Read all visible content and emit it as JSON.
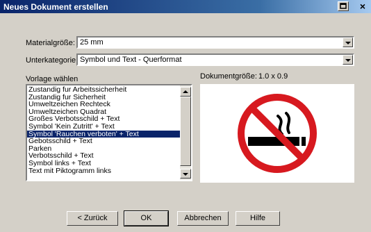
{
  "window": {
    "title": "Neues Dokument erstellen",
    "close_glyph": "×"
  },
  "material": {
    "label": "Materialgröße:",
    "value": "25 mm"
  },
  "subcategory": {
    "label": "Unterkategorie:",
    "value": "Symbol und Text - Querformat"
  },
  "template": {
    "label": "Vorlage wählen",
    "items": [
      "Zustandig fur Arbeitssicherheit",
      "Zustandig fur Sicherheit",
      "Umweltzeichen Rechteck",
      "Umweltzeichen Quadrat",
      "Großes Verbotsschild + Text",
      "Symbol 'Kein Zutritt' + Text",
      "Symbol 'Rauchen verboten' + Text",
      "Gebotsschild + Text",
      "Parken",
      "Verbotsschild + Text",
      "Symbol links + Text",
      "Text mit Piktogramm links"
    ],
    "selected_index": 6
  },
  "document_size": {
    "label": "Dokumentgröße:",
    "value": "1.0 x 0.9"
  },
  "preview": {
    "icon": "no-smoking-icon",
    "colors": {
      "ring": "#d7191f",
      "symbol": "#000000"
    }
  },
  "buttons": {
    "back": "< Zurück",
    "ok": "OK",
    "cancel": "Abbrechen",
    "help": "Hilfe"
  }
}
